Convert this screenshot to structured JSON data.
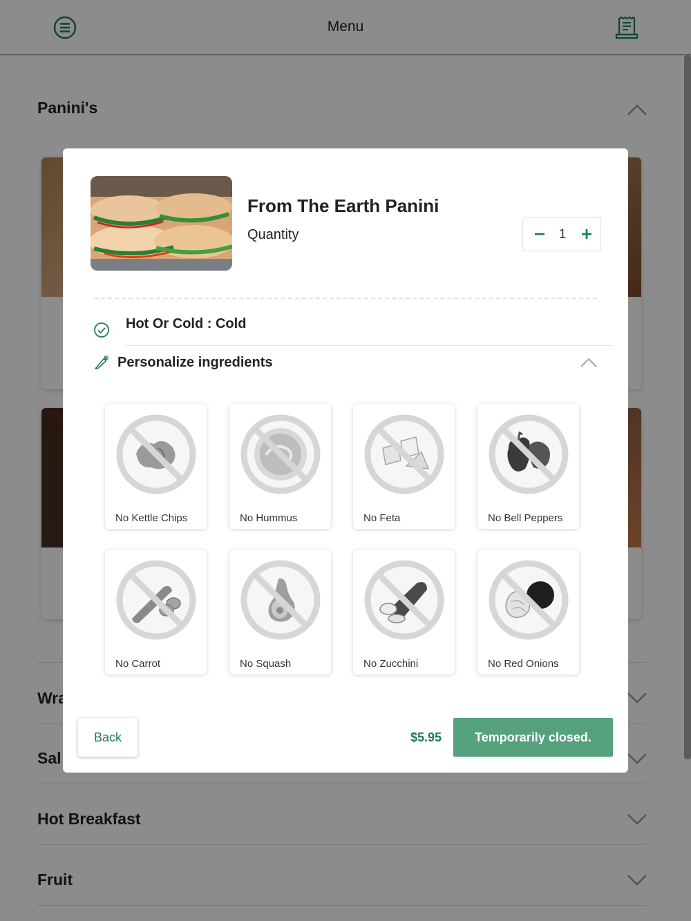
{
  "header": {
    "title": "Menu",
    "menu_icon": "hamburger-circle-icon",
    "receipt_icon": "receipt-icon"
  },
  "sections": [
    {
      "title": "Panini's",
      "expanded": true
    },
    {
      "title": "Wra",
      "expanded": false
    },
    {
      "title": "Sal",
      "expanded": false
    },
    {
      "title": "Hot Breakfast",
      "expanded": false
    },
    {
      "title": "Fruit",
      "expanded": false
    }
  ],
  "modal": {
    "product_name": "From The Earth Panini",
    "quantity_label": "Quantity",
    "quantity_value": "1",
    "option_text": "Hot Or Cold : Cold",
    "personalize_label": "Personalize ingredients",
    "ingredients": [
      {
        "label": "No Kettle Chips",
        "icon": "kettle-chips-icon"
      },
      {
        "label": "No Hummus",
        "icon": "hummus-icon"
      },
      {
        "label": "No Feta",
        "icon": "feta-icon"
      },
      {
        "label": "No Bell Peppers",
        "icon": "bell-peppers-icon"
      },
      {
        "label": "No Carrot",
        "icon": "carrot-icon"
      },
      {
        "label": "No Squash",
        "icon": "squash-icon"
      },
      {
        "label": "No Zucchini",
        "icon": "zucchini-icon"
      },
      {
        "label": "No Red Onions",
        "icon": "red-onions-icon"
      }
    ],
    "back_label": "Back",
    "price": "$5.95",
    "closed_label": "Temporarily closed."
  },
  "colors": {
    "brand_green": "#1e7d56",
    "button_green": "#55a17e",
    "header_border": "#2f6b3f"
  }
}
